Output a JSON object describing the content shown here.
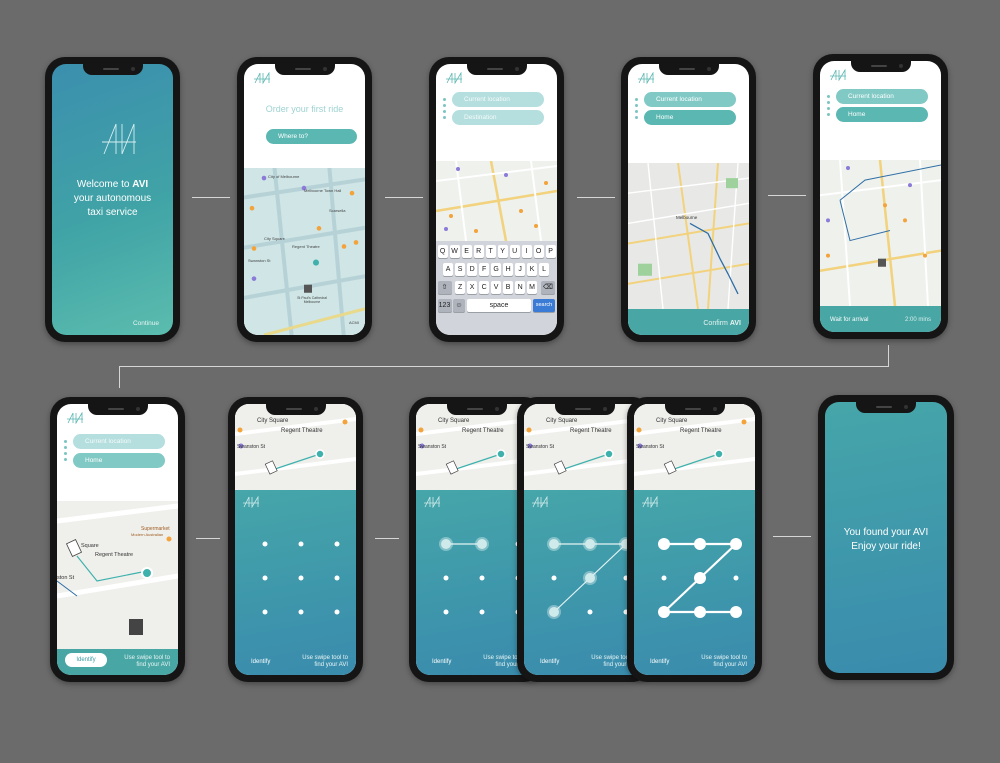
{
  "screens": {
    "welcome": {
      "line1": "Welcome to",
      "brand": "AVI",
      "line2": "your autonomous",
      "line3": "taxi service",
      "continue": "Continue"
    },
    "order": {
      "title": "Order your first ride",
      "where_to": "Where to?"
    },
    "search": {
      "current_location": "Current location",
      "destination_placeholder": "Destination"
    },
    "confirm": {
      "current_location": "Current location",
      "home": "Home",
      "confirm_label": "Confirm",
      "brand": "AVI"
    },
    "waiting": {
      "current_location": "Current location",
      "home": "Home",
      "wait_for_arrival": "Wait for arrival",
      "est_time": "2:00 mins"
    },
    "arrived": {
      "current_location": "Current location",
      "home": "Home",
      "identify": "Identify",
      "hint_line1": "Use swipe tool to",
      "hint_line2": "find your AVI"
    },
    "pattern": {
      "identify": "Identify",
      "hint_line1": "Use swipe tool to",
      "hint_line2": "find your AVI"
    },
    "found": {
      "line1": "You found your AVI",
      "line2": "Enjoy your ride!"
    }
  },
  "map_labels": {
    "city_square": "City Square",
    "regent_theatre": "Regent Theatre",
    "swanston": "Swanston St",
    "supermarket": "Supermarket",
    "modern_aust": "Modern Australian",
    "square": "Square",
    "regent_theatre_short": "Regent Theatre",
    "swanston_short": "ston St",
    "melbourne": "Melbourne",
    "melbourne_town_hall": "Melbourne Town Hall",
    "st_pauls": "St Paul's Cathedral Melbourne",
    "city_of_melbourne": "City of Melbourne",
    "scarsella": "Scarsella",
    "acmi": "ACMI",
    "city_square_short": "City Square",
    "regent_short": "Regent Theatre"
  },
  "keyboard": {
    "row1": [
      "Q",
      "W",
      "E",
      "R",
      "T",
      "Y",
      "U",
      "I",
      "O",
      "P"
    ],
    "row2": [
      "A",
      "S",
      "D",
      "F",
      "G",
      "H",
      "J",
      "K",
      "L"
    ],
    "row3": [
      "Z",
      "X",
      "C",
      "V",
      "B",
      "N",
      "M"
    ],
    "num": "123",
    "space": "space",
    "search": "search"
  },
  "colors": {
    "teal": "#48a6a4",
    "teal_dark": "#3a8bad",
    "pill_light": "#b5dede",
    "background": "#6b6b6b"
  }
}
